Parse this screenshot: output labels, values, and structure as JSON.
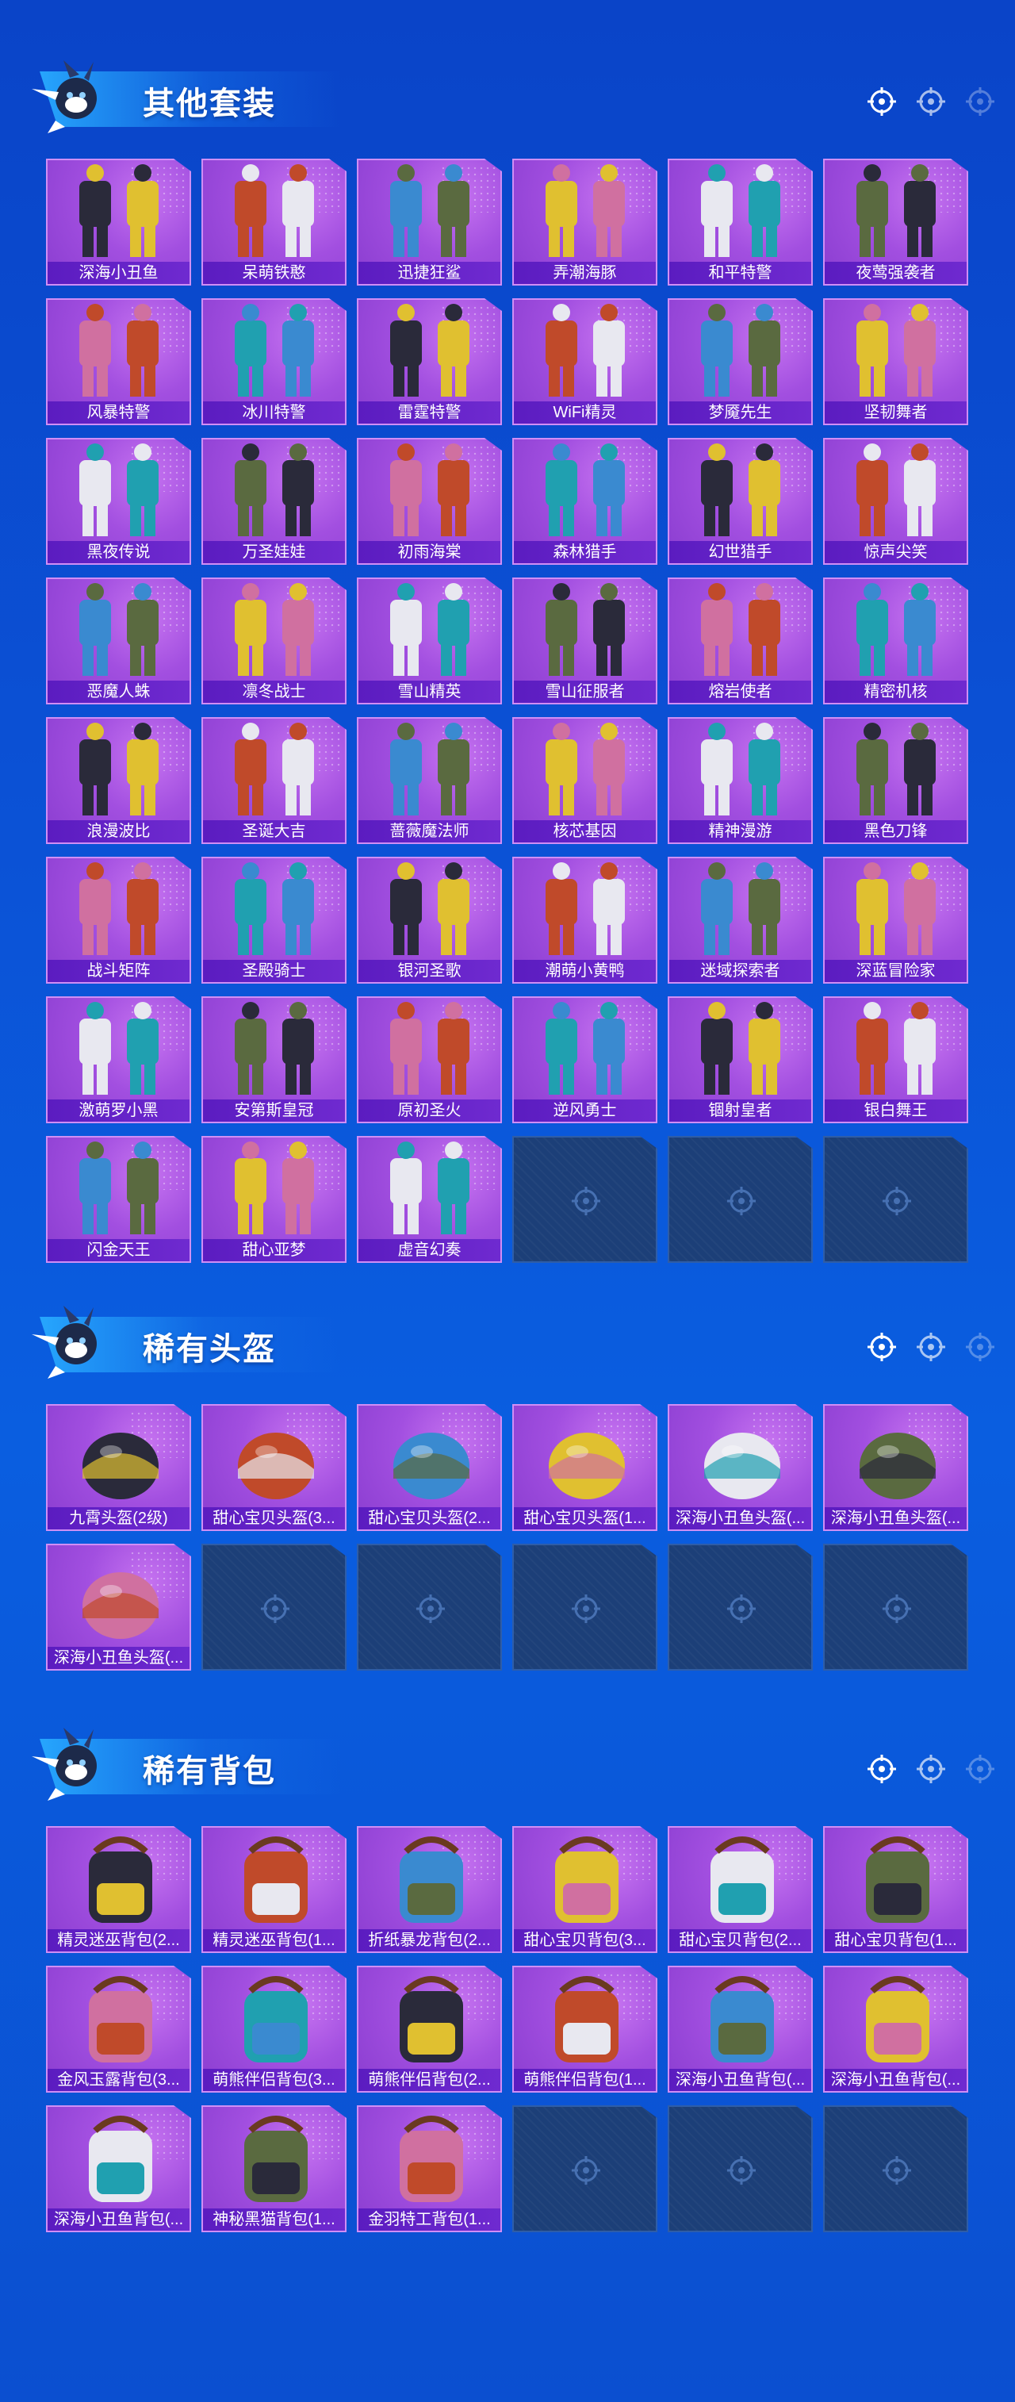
{
  "colors": {
    "card": "#a24fe0",
    "label_bg": "#5b1cc0",
    "empty_slot": "#1c3f78",
    "page_bg": "#0a4fd0"
  },
  "sections": [
    {
      "title": "其他套装",
      "items": [
        "深海小丑鱼",
        "呆萌铁憨",
        "迅捷狂鲨",
        "弄潮海豚",
        "和平特警",
        "夜莺强袭者",
        "风暴特警",
        "冰川特警",
        "雷霆特警",
        "WiFi精灵",
        "梦魇先生",
        "坚韧舞者",
        "黑夜传说",
        "万圣娃娃",
        "初雨海棠",
        "森林猎手",
        "幻世猎手",
        "惊声尖笑",
        "恶魔人蛛",
        "凛冬战士",
        "雪山精英",
        "雪山征服者",
        "熔岩使者",
        "精密机核",
        "浪漫波比",
        "圣诞大吉",
        "蔷薇魔法师",
        "核芯基因",
        "精神漫游",
        "黑色刀锋",
        "战斗矩阵",
        "圣殿骑士",
        "银河圣歌",
        "潮萌小黄鸭",
        "迷域探索者",
        "深蓝冒险家",
        "激萌罗小黑",
        "安第斯皇冠",
        "原初圣火",
        "逆风勇士",
        "锢射皇者",
        "银白舞王",
        "闪金天王",
        "甜心亚梦",
        "虚音幻奏"
      ],
      "empty_slots": 3
    },
    {
      "title": "稀有头盔",
      "items": [
        "九霄头盔(2级)",
        "甜心宝贝头盔(3...",
        "甜心宝贝头盔(2...",
        "甜心宝贝头盔(1...",
        "深海小丑鱼头盔(...",
        "深海小丑鱼头盔(...",
        "深海小丑鱼头盔(..."
      ],
      "empty_slots": 5
    },
    {
      "title": "稀有背包",
      "items": [
        "精灵迷巫背包(2...",
        "精灵迷巫背包(1...",
        "折纸暴龙背包(2...",
        "甜心宝贝背包(3...",
        "甜心宝贝背包(2...",
        "甜心宝贝背包(1...",
        "金风玉露背包(3...",
        "萌熊伴侣背包(3...",
        "萌熊伴侣背包(2...",
        "萌熊伴侣背包(1...",
        "深海小丑鱼背包(...",
        "深海小丑鱼背包(...",
        "深海小丑鱼背包(...",
        "神秘黑猫背包(1...",
        "金羽特工背包(1..."
      ],
      "empty_slots": 3
    }
  ]
}
